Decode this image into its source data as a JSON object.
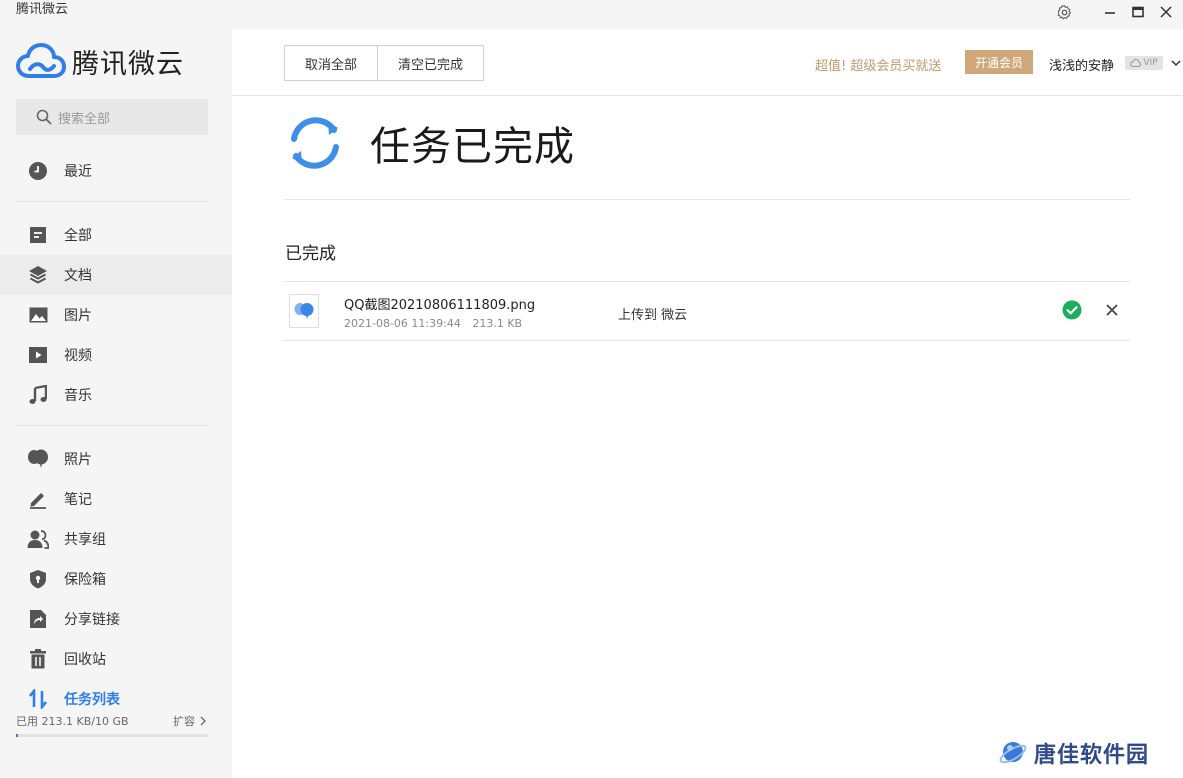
{
  "window": {
    "title": "腾讯微云"
  },
  "sidebar": {
    "logo_text": "腾讯微云",
    "search_placeholder": "搜索全部",
    "items": [
      {
        "label": "最近",
        "icon": "clock-icon"
      },
      {
        "label": "全部",
        "icon": "all-files-icon"
      },
      {
        "label": "文档",
        "icon": "layers-icon"
      },
      {
        "label": "图片",
        "icon": "image-icon"
      },
      {
        "label": "视频",
        "icon": "video-icon"
      },
      {
        "label": "音乐",
        "icon": "music-icon"
      },
      {
        "label": "照片",
        "icon": "photo-balloon-icon"
      },
      {
        "label": "笔记",
        "icon": "pen-icon"
      },
      {
        "label": "共享组",
        "icon": "group-icon"
      },
      {
        "label": "保险箱",
        "icon": "shield-icon"
      },
      {
        "label": "分享链接",
        "icon": "share-link-icon"
      },
      {
        "label": "回收站",
        "icon": "trash-icon"
      },
      {
        "label": "任务列表",
        "icon": "transfer-icon",
        "active": true
      }
    ],
    "storage_text": "已用 213.1 KB/10 GB",
    "storage_used_fraction": 2e-05,
    "expand_label": "扩容"
  },
  "header": {
    "cancel_all_label": "取消全部",
    "clear_done_label": "清空已完成",
    "promo_text": "超值!  超级会员买就送",
    "open_vip_label": "开通会员",
    "username": "浅浅的安静",
    "vip_badge": "VIP"
  },
  "main": {
    "status_title": "任务已完成",
    "section_title": "已完成",
    "tasks": [
      {
        "file_name": "QQ截图20210806111809.png",
        "timestamp": "2021-08-06 11:39:44",
        "size": "213.1 KB",
        "status": "上传到 微云"
      }
    ]
  },
  "watermark": {
    "text": "唐佳软件园"
  },
  "colors": {
    "accent": "#2f7ee9",
    "success": "#1aad5b",
    "vip_gold": "#d0a778",
    "promo": "#c1996a"
  }
}
